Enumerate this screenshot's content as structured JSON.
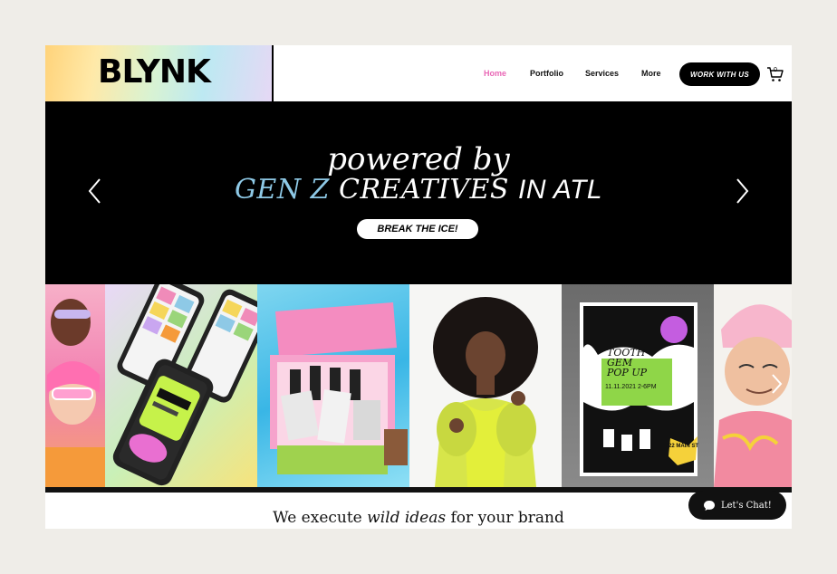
{
  "brand": {
    "logo": "BLYNK"
  },
  "nav": {
    "items": [
      {
        "label": "Home",
        "active": true
      },
      {
        "label": "Portfolio",
        "active": false
      },
      {
        "label": "Services",
        "active": false
      },
      {
        "label": "More",
        "active": false
      }
    ],
    "cta_label": "WORK WITH US",
    "cart_count": "0"
  },
  "hero": {
    "line1": "powered by",
    "line2_accent": "GEN Z",
    "line2_main": "CREATIVES",
    "line2_tail": "IN ATL",
    "button_label": "BREAK THE ICE!"
  },
  "gallery": {
    "tile4": {
      "sign_line1": "TOOTH",
      "sign_line2": "GEM",
      "sign_line3": "POP UP",
      "sign_date": "11.11.2021 2-6PM",
      "badge": "22 MAIN ST"
    }
  },
  "tagline": {
    "before": "We execute ",
    "emphasis": "wild ideas",
    "after": " for your brand"
  },
  "chat": {
    "label": "Let's Chat!"
  },
  "colors": {
    "accent_pink": "#e968b6",
    "accent_blue": "#8ec9e6",
    "hero_bg": "#000000"
  }
}
